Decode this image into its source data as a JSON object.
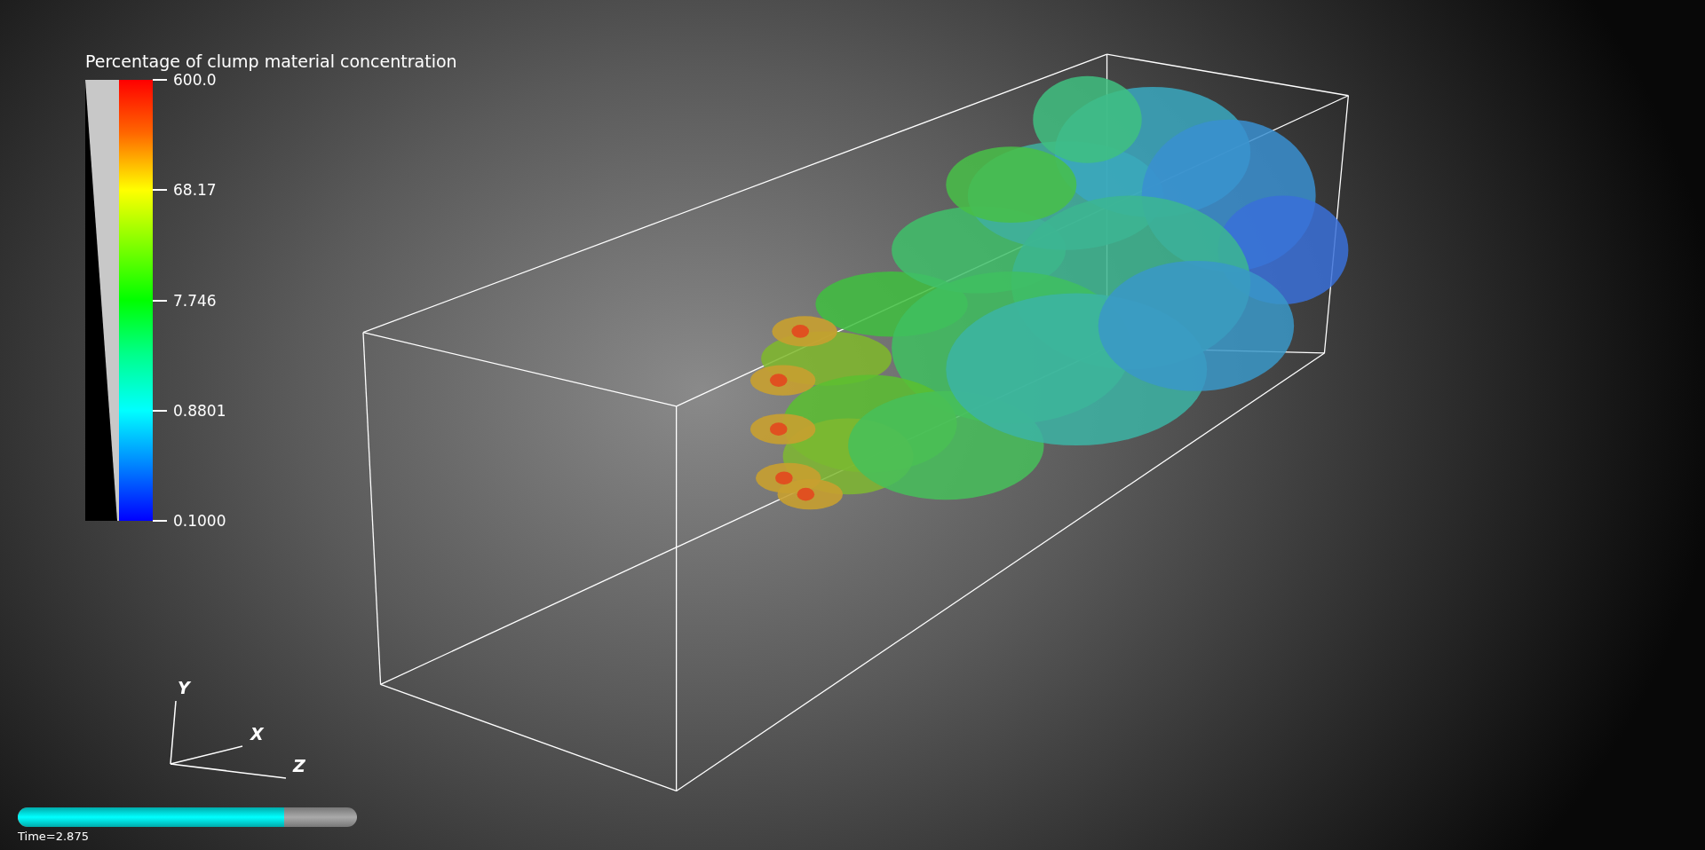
{
  "legend": {
    "title": "Percentage of clump material concentration",
    "ticks": [
      "600.0",
      "68.17",
      "7.746",
      "0.8801",
      "0.1000"
    ]
  },
  "orientation_axes": {
    "labels": [
      "Y",
      "X",
      "Z"
    ]
  },
  "time": {
    "label": "Time=2.875",
    "level": 0.785
  }
}
